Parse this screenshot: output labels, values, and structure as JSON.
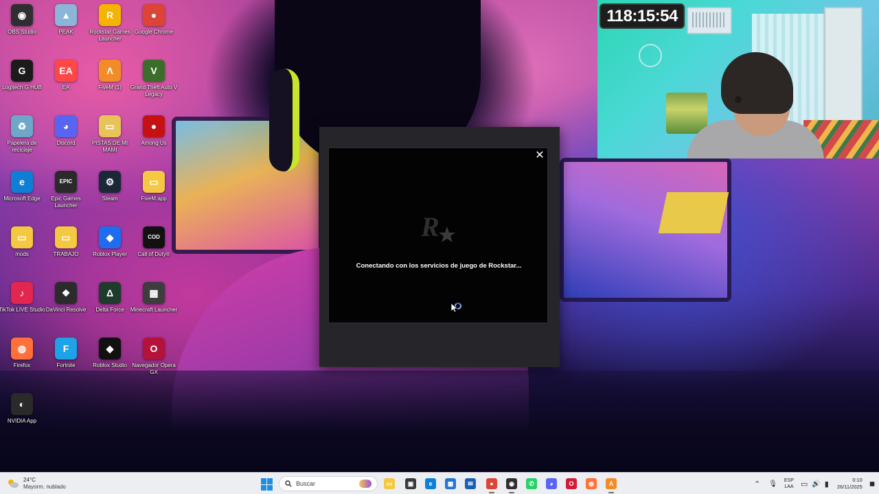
{
  "desktop_icons": [
    {
      "id": "obs",
      "label": "OBS Studio",
      "glyph": "◉",
      "color": "#302e31"
    },
    {
      "id": "peak",
      "label": "PEAK",
      "glyph": "▲",
      "color": "#8bb6d8"
    },
    {
      "id": "rockstar",
      "label": "Rockstar Games Launcher",
      "glyph": "R",
      "color": "#f4b400"
    },
    {
      "id": "chrome",
      "label": "Google Chrome",
      "glyph": "●",
      "color": "#db4437"
    },
    {
      "id": "ghub",
      "label": "Logitech G HUB",
      "glyph": "G",
      "color": "#1b1b1b"
    },
    {
      "id": "ea",
      "label": "EA",
      "glyph": "EA",
      "color": "#ff4747"
    },
    {
      "id": "fivem",
      "label": "FiveM (1)",
      "glyph": "Λ",
      "color": "#f28c28"
    },
    {
      "id": "gtav",
      "label": "Grand Theft Auto V Legacy",
      "glyph": "V",
      "color": "#3b6e2a"
    },
    {
      "id": "recycle",
      "label": "Papelera de reciclaje",
      "glyph": "♻",
      "color": "#6fa7c9"
    },
    {
      "id": "discord",
      "label": "Discord",
      "glyph": "◕",
      "color": "#5865f2"
    },
    {
      "id": "pistas",
      "label": "PISTAS DE MI MAMI",
      "glyph": "▭",
      "color": "#e8c35a"
    },
    {
      "id": "amongus",
      "label": "Among Us",
      "glyph": "●",
      "color": "#c51111"
    },
    {
      "id": "edge",
      "label": "Microsoft Edge",
      "glyph": "e",
      "color": "#0f7fd6"
    },
    {
      "id": "epic",
      "label": "Epic Games Launcher",
      "glyph": "EPIC",
      "color": "#2a2a2a"
    },
    {
      "id": "steam",
      "label": "Steam",
      "glyph": "⚙",
      "color": "#1b2838"
    },
    {
      "id": "fivemapp",
      "label": "FiveM.app",
      "glyph": "▭",
      "color": "#f5c842"
    },
    {
      "id": "mods",
      "label": "mods",
      "glyph": "▭",
      "color": "#f5c842"
    },
    {
      "id": "trabajo",
      "label": "TRABAJO",
      "glyph": "▭",
      "color": "#f5c842"
    },
    {
      "id": "roblox",
      "label": "Roblox Player",
      "glyph": "◆",
      "color": "#1e6cf0"
    },
    {
      "id": "cod",
      "label": "Call of Duty®",
      "glyph": "COD",
      "color": "#111111"
    },
    {
      "id": "tiktok",
      "label": "TikTok LIVE Studio",
      "glyph": "♪",
      "color": "#e3264f"
    },
    {
      "id": "davinci",
      "label": "DaVinci Resolve",
      "glyph": "❖",
      "color": "#2b2b2b"
    },
    {
      "id": "deltaforce",
      "label": "Delta Force",
      "glyph": "Δ",
      "color": "#1e3b2b"
    },
    {
      "id": "minecraft",
      "label": "Minecraft Launcher",
      "glyph": "▦",
      "color": "#3d3d3d"
    },
    {
      "id": "firefox",
      "label": "Firefox",
      "glyph": "◍",
      "color": "#ff7139"
    },
    {
      "id": "fortnite",
      "label": "Fortnite",
      "glyph": "F",
      "color": "#1ea3e8"
    },
    {
      "id": "robloxstudio",
      "label": "Roblox Studio",
      "glyph": "◆",
      "color": "#111111"
    },
    {
      "id": "operagx",
      "label": "Navegador Opera GX",
      "glyph": "O",
      "color": "#b4123a"
    },
    {
      "id": "nvidia",
      "label": "NVIDIA App",
      "glyph": "◐",
      "color": "#2a2a2a"
    }
  ],
  "dialog": {
    "message": "Conectando con los servicios de juego de Rockstar...",
    "close_glyph": "✕",
    "logo_glyph": "R★"
  },
  "stream_overlay": {
    "timer": "118:15:54"
  },
  "taskbar": {
    "weather_temp": "24°C",
    "weather_condition": "Mayorm. nublado",
    "search_placeholder": "Buscar",
    "pinned_apps": [
      {
        "id": "file-explorer-icon",
        "glyph": "▭",
        "color": "#f5c842"
      },
      {
        "id": "task-view-icon",
        "glyph": "▣",
        "color": "#3a3a3a"
      },
      {
        "id": "edge-icon",
        "glyph": "e",
        "color": "#0f7fd6"
      },
      {
        "id": "store-icon",
        "glyph": "▦",
        "color": "#2672d6"
      },
      {
        "id": "outlook-icon",
        "glyph": "✉",
        "color": "#1a5fb4"
      },
      {
        "id": "chrome-icon",
        "glyph": "●",
        "color": "#db4437"
      },
      {
        "id": "obs-icon",
        "glyph": "◉",
        "color": "#302e31"
      },
      {
        "id": "whatsapp-icon",
        "glyph": "✆",
        "color": "#25d366"
      },
      {
        "id": "discord-icon",
        "glyph": "◕",
        "color": "#5865f2"
      },
      {
        "id": "opera-icon",
        "glyph": "O",
        "color": "#d21a3a"
      },
      {
        "id": "firefox-icon",
        "glyph": "◍",
        "color": "#ff7139"
      },
      {
        "id": "fivem-icon",
        "glyph": "Λ",
        "color": "#f28c28"
      }
    ],
    "tray": {
      "chevron_glyph": "⌃",
      "mic_glyph": "🎙",
      "lang_line1": "ESP",
      "lang_line2": "LAA",
      "network_glyph": "▭",
      "volume_glyph": "🔊",
      "battery_glyph": "▮",
      "time": "0:10",
      "date": "26/11/2025",
      "notification_glyph": "◼"
    }
  }
}
